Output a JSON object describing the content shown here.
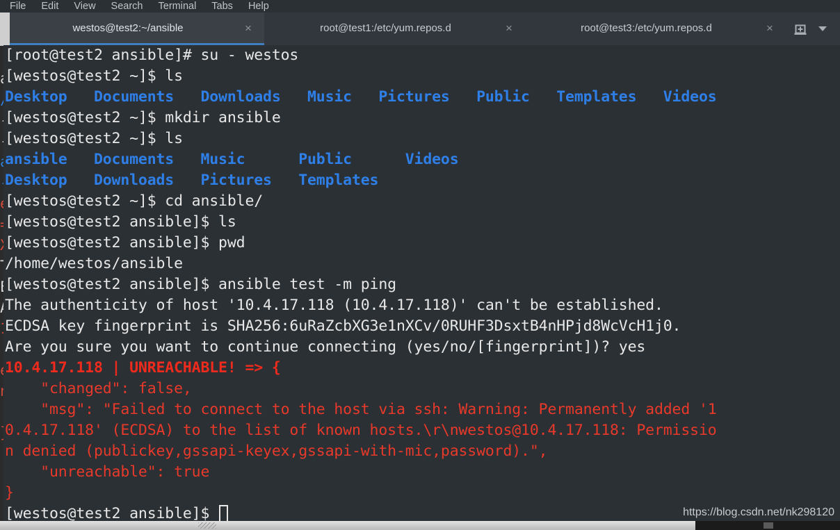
{
  "window": {
    "title": "westos@test2:~/ansible"
  },
  "menubar": {
    "items": [
      {
        "label": "File"
      },
      {
        "label": "Edit"
      },
      {
        "label": "View"
      },
      {
        "label": "Search"
      },
      {
        "label": "Terminal"
      },
      {
        "label": "Tabs"
      },
      {
        "label": "Help"
      }
    ]
  },
  "tabs": {
    "items": [
      {
        "title": "westos@test2:~/ansible",
        "close": "×",
        "active": true
      },
      {
        "title": "root@test1:/etc/yum.repos.d",
        "close": "×",
        "active": false
      },
      {
        "title": "root@test3:/etc/yum.repos.d",
        "close": "×",
        "active": false
      }
    ],
    "new_tab_icon": "new-tab-icon",
    "tab_menu_icon": "chevron-down-icon"
  },
  "terminal": {
    "colors": {
      "background": "#2b3034",
      "foreground": "#e8e8e8",
      "directory_blue": "#2f7fe8",
      "error_red": "#e8392a",
      "accent_blue": "#3f7fbf"
    },
    "lines": [
      {
        "id": "l1",
        "color": "white",
        "text": "[root@test2 ansible]# su - westos"
      },
      {
        "id": "l2",
        "color": "white",
        "text": "[westos@test2 ~]$ ls"
      },
      {
        "id": "l3",
        "color": "blue",
        "text": "Desktop   Documents   Downloads   Music   Pictures   Public   Templates   Videos"
      },
      {
        "id": "l4",
        "color": "white",
        "text": "[westos@test2 ~]$ mkdir ansible"
      },
      {
        "id": "l5",
        "color": "white",
        "text": "[westos@test2 ~]$ ls"
      },
      {
        "id": "l6",
        "color": "blue",
        "text": "ansible   Documents   Music      Public      Videos"
      },
      {
        "id": "l7",
        "color": "blue",
        "text": "Desktop   Downloads   Pictures   Templates"
      },
      {
        "id": "l8",
        "color": "white",
        "text": "[westos@test2 ~]$ cd ansible/"
      },
      {
        "id": "l9",
        "color": "white",
        "text": "[westos@test2 ansible]$ ls"
      },
      {
        "id": "l10",
        "color": "white",
        "text": "[westos@test2 ansible]$ pwd"
      },
      {
        "id": "l11",
        "color": "white",
        "text": "/home/westos/ansible"
      },
      {
        "id": "l12",
        "color": "white",
        "text": "[westos@test2 ansible]$ ansible test -m ping"
      },
      {
        "id": "l13",
        "color": "white",
        "text": "The authenticity of host '10.4.17.118 (10.4.17.118)' can't be established."
      },
      {
        "id": "l14",
        "color": "white",
        "text": "ECDSA key fingerprint is SHA256:6uRaZcbXG3e1nXCv/0RUHF3DsxtB4nHPjd8WcVcH1j0."
      },
      {
        "id": "l15",
        "color": "white",
        "text": "Are you sure you want to continue connecting (yes/no/[fingerprint])? yes"
      },
      {
        "id": "l16",
        "color": "redbold",
        "text": "10.4.17.118 | UNREACHABLE! => {"
      },
      {
        "id": "l17",
        "color": "red",
        "text": "    \"changed\": false,"
      },
      {
        "id": "l18",
        "color": "red",
        "text": "    \"msg\": \"Failed to connect to the host via ssh: Warning: Permanently added '1"
      },
      {
        "id": "l19",
        "color": "red",
        "text": "0.4.17.118' (ECDSA) to the list of known hosts.\\r\\nwestos@10.4.17.118: Permissio"
      },
      {
        "id": "l20",
        "color": "red",
        "text": "n denied (publickey,gssapi-keyex,gssapi-with-mic,password).\","
      },
      {
        "id": "l21",
        "color": "red",
        "text": "    \"unreachable\": true"
      },
      {
        "id": "l22",
        "color": "red",
        "text": "}"
      }
    ],
    "prompt": "[westos@test2 ansible]$ ",
    "cursor": "block-cursor"
  },
  "background_window": {
    "fragments": [
      {
        "color": "white",
        "text": " "
      },
      {
        "color": "white",
        "text": "a"
      },
      {
        "color": "blue",
        "text": "/"
      },
      {
        "color": "white",
        "text": "-"
      },
      {
        "color": "white",
        "text": "-"
      },
      {
        "color": "blue",
        "text": "a"
      },
      {
        "color": "blue",
        "text": "-"
      },
      {
        "color": "red",
        "text": "e"
      },
      {
        "color": "red",
        "text": "="
      },
      {
        "color": "red",
        "text": "X"
      },
      {
        "color": "white",
        "text": "T"
      },
      {
        "color": "white",
        "text": "E"
      },
      {
        "color": "white",
        "text": "A"
      },
      {
        "color": "red",
        "text": "1"
      },
      {
        "color": "red",
        "text": " "
      },
      {
        "color": "red",
        "text": "e"
      },
      {
        "color": "red",
        "text": "n"
      },
      {
        "color": "red",
        "text": " "
      },
      {
        "color": "red",
        "text": "}"
      },
      {
        "color": "white",
        "text": " "
      }
    ]
  },
  "watermark": {
    "text": "https://blog.csdn.net/nk298120"
  }
}
